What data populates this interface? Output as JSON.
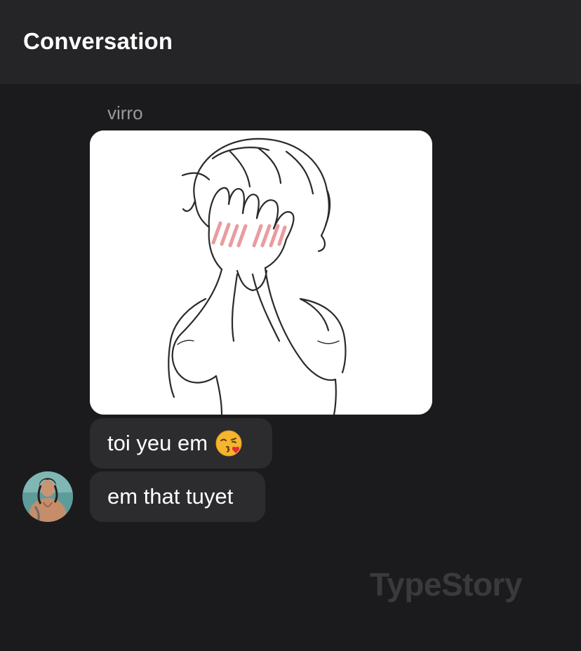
{
  "header": {
    "title": "Conversation"
  },
  "message_group": {
    "sender_name": "virro",
    "image": {
      "description_icon": "anime-boy-covering-face-image"
    },
    "messages": [
      {
        "text": "toi yeu em",
        "emoji": "face-blowing-kiss-emoji"
      },
      {
        "text": "em that tuyet"
      }
    ],
    "avatar_icon": "user-avatar"
  },
  "watermark": {
    "text": "TypeStory"
  },
  "colors": {
    "background": "#1b1b1d",
    "header": "#252527",
    "bubble": "#2c2c2e",
    "sender_name": "#9a9a9e",
    "watermark": "#3a3a3d"
  }
}
